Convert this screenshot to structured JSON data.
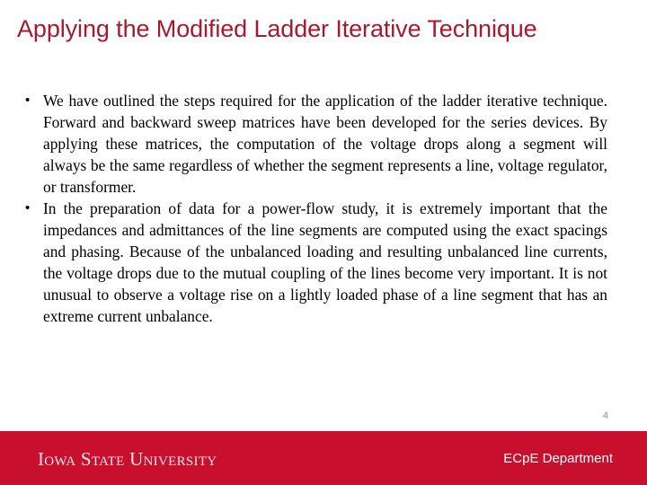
{
  "slide": {
    "title": "Applying the Modified Ladder Iterative Technique",
    "bullet_glyph": "•",
    "bullets": [
      "We have outlined the steps required for the application of the ladder iterative technique. Forward and backward sweep matrices have been developed for the series devices. By applying these matrices, the computation of the voltage drops along a segment will always be the same regardless of whether the segment represents a line, voltage regulator, or transformer.",
      "In the preparation of data for a power-flow study, it is extremely important that the impedances and admittances of the line segments are computed using the exact spacings and phasing. Because of the unbalanced loading and resulting unbalanced line currents, the voltage drops due to the mutual coupling of the lines become very important. It is not unusual to observe a voltage rise on a lightly loaded phase of a line segment that has an extreme current unbalance."
    ],
    "page_number": "4"
  },
  "footer": {
    "logo_text": "Iowa State University",
    "department": "ECpE Department"
  },
  "colors": {
    "title": "#A6192E",
    "footer_band": "#C8102E",
    "body_text": "#000000",
    "page_number": "#8a8a8a"
  }
}
